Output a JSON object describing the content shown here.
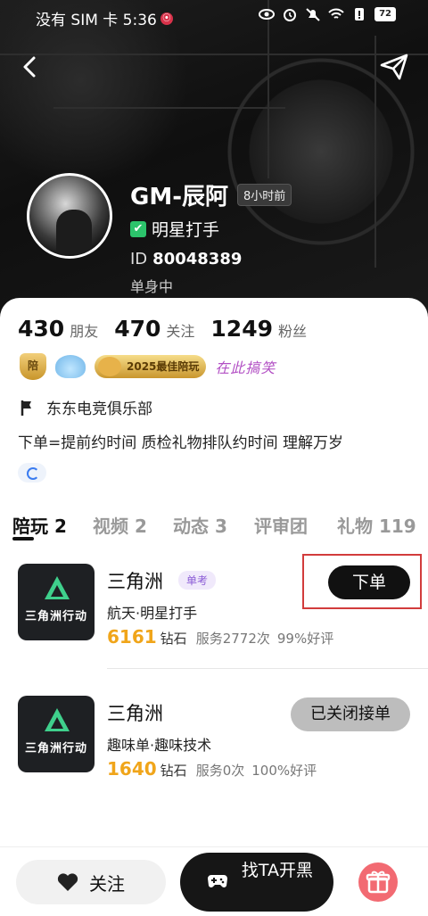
{
  "status_bar": {
    "carrier_time": "没有 SIM 卡 5:36",
    "battery": "72"
  },
  "profile": {
    "name": "GM-辰阿",
    "last_seen": "8小时前",
    "verified_label": "明星打手",
    "id_label": "ID",
    "id_value": "80048389",
    "relationship": "单身中"
  },
  "stats": [
    {
      "value": "430",
      "label": "朋友"
    },
    {
      "value": "470",
      "label": "关注"
    },
    {
      "value": "1249",
      "label": "粉丝"
    }
  ],
  "medals": {
    "shield": "陪",
    "badge_2025": "2025最佳陪玩",
    "script": "在此搞笑"
  },
  "club": "东东电竞俱乐部",
  "bio": "下单=提前约时间  质检礼物排队约时间 理解万岁",
  "tabs": [
    {
      "label": "陪玩 2"
    },
    {
      "label": "视频 2"
    },
    {
      "label": "动态 3"
    },
    {
      "label": "评审团"
    },
    {
      "label": "礼物 119"
    }
  ],
  "services": [
    {
      "thumb_text": "三角洲行动",
      "title": "三角洲",
      "tag": "单考",
      "subtitle": "航天·明星打手",
      "price": "6161",
      "unit": "钻石",
      "service_count": "服务2772次",
      "rating": "99%好评",
      "button": "下单"
    },
    {
      "thumb_text": "三角洲行动",
      "title": "三角洲",
      "subtitle": "趣味单·趣味技术",
      "price": "1640",
      "unit": "钻石",
      "service_count": "服务0次",
      "rating": "100%好评",
      "button": "已关闭接单"
    }
  ],
  "bottom_bar": {
    "follow": "关注",
    "find": "找TA开黑"
  },
  "colors": {
    "accent_price": "#f0a51a",
    "verified_green": "#2cc36b",
    "tag_purple": "#8b5cd6",
    "gift_red": "#f26a72",
    "highlight_red": "#d23c3c"
  }
}
